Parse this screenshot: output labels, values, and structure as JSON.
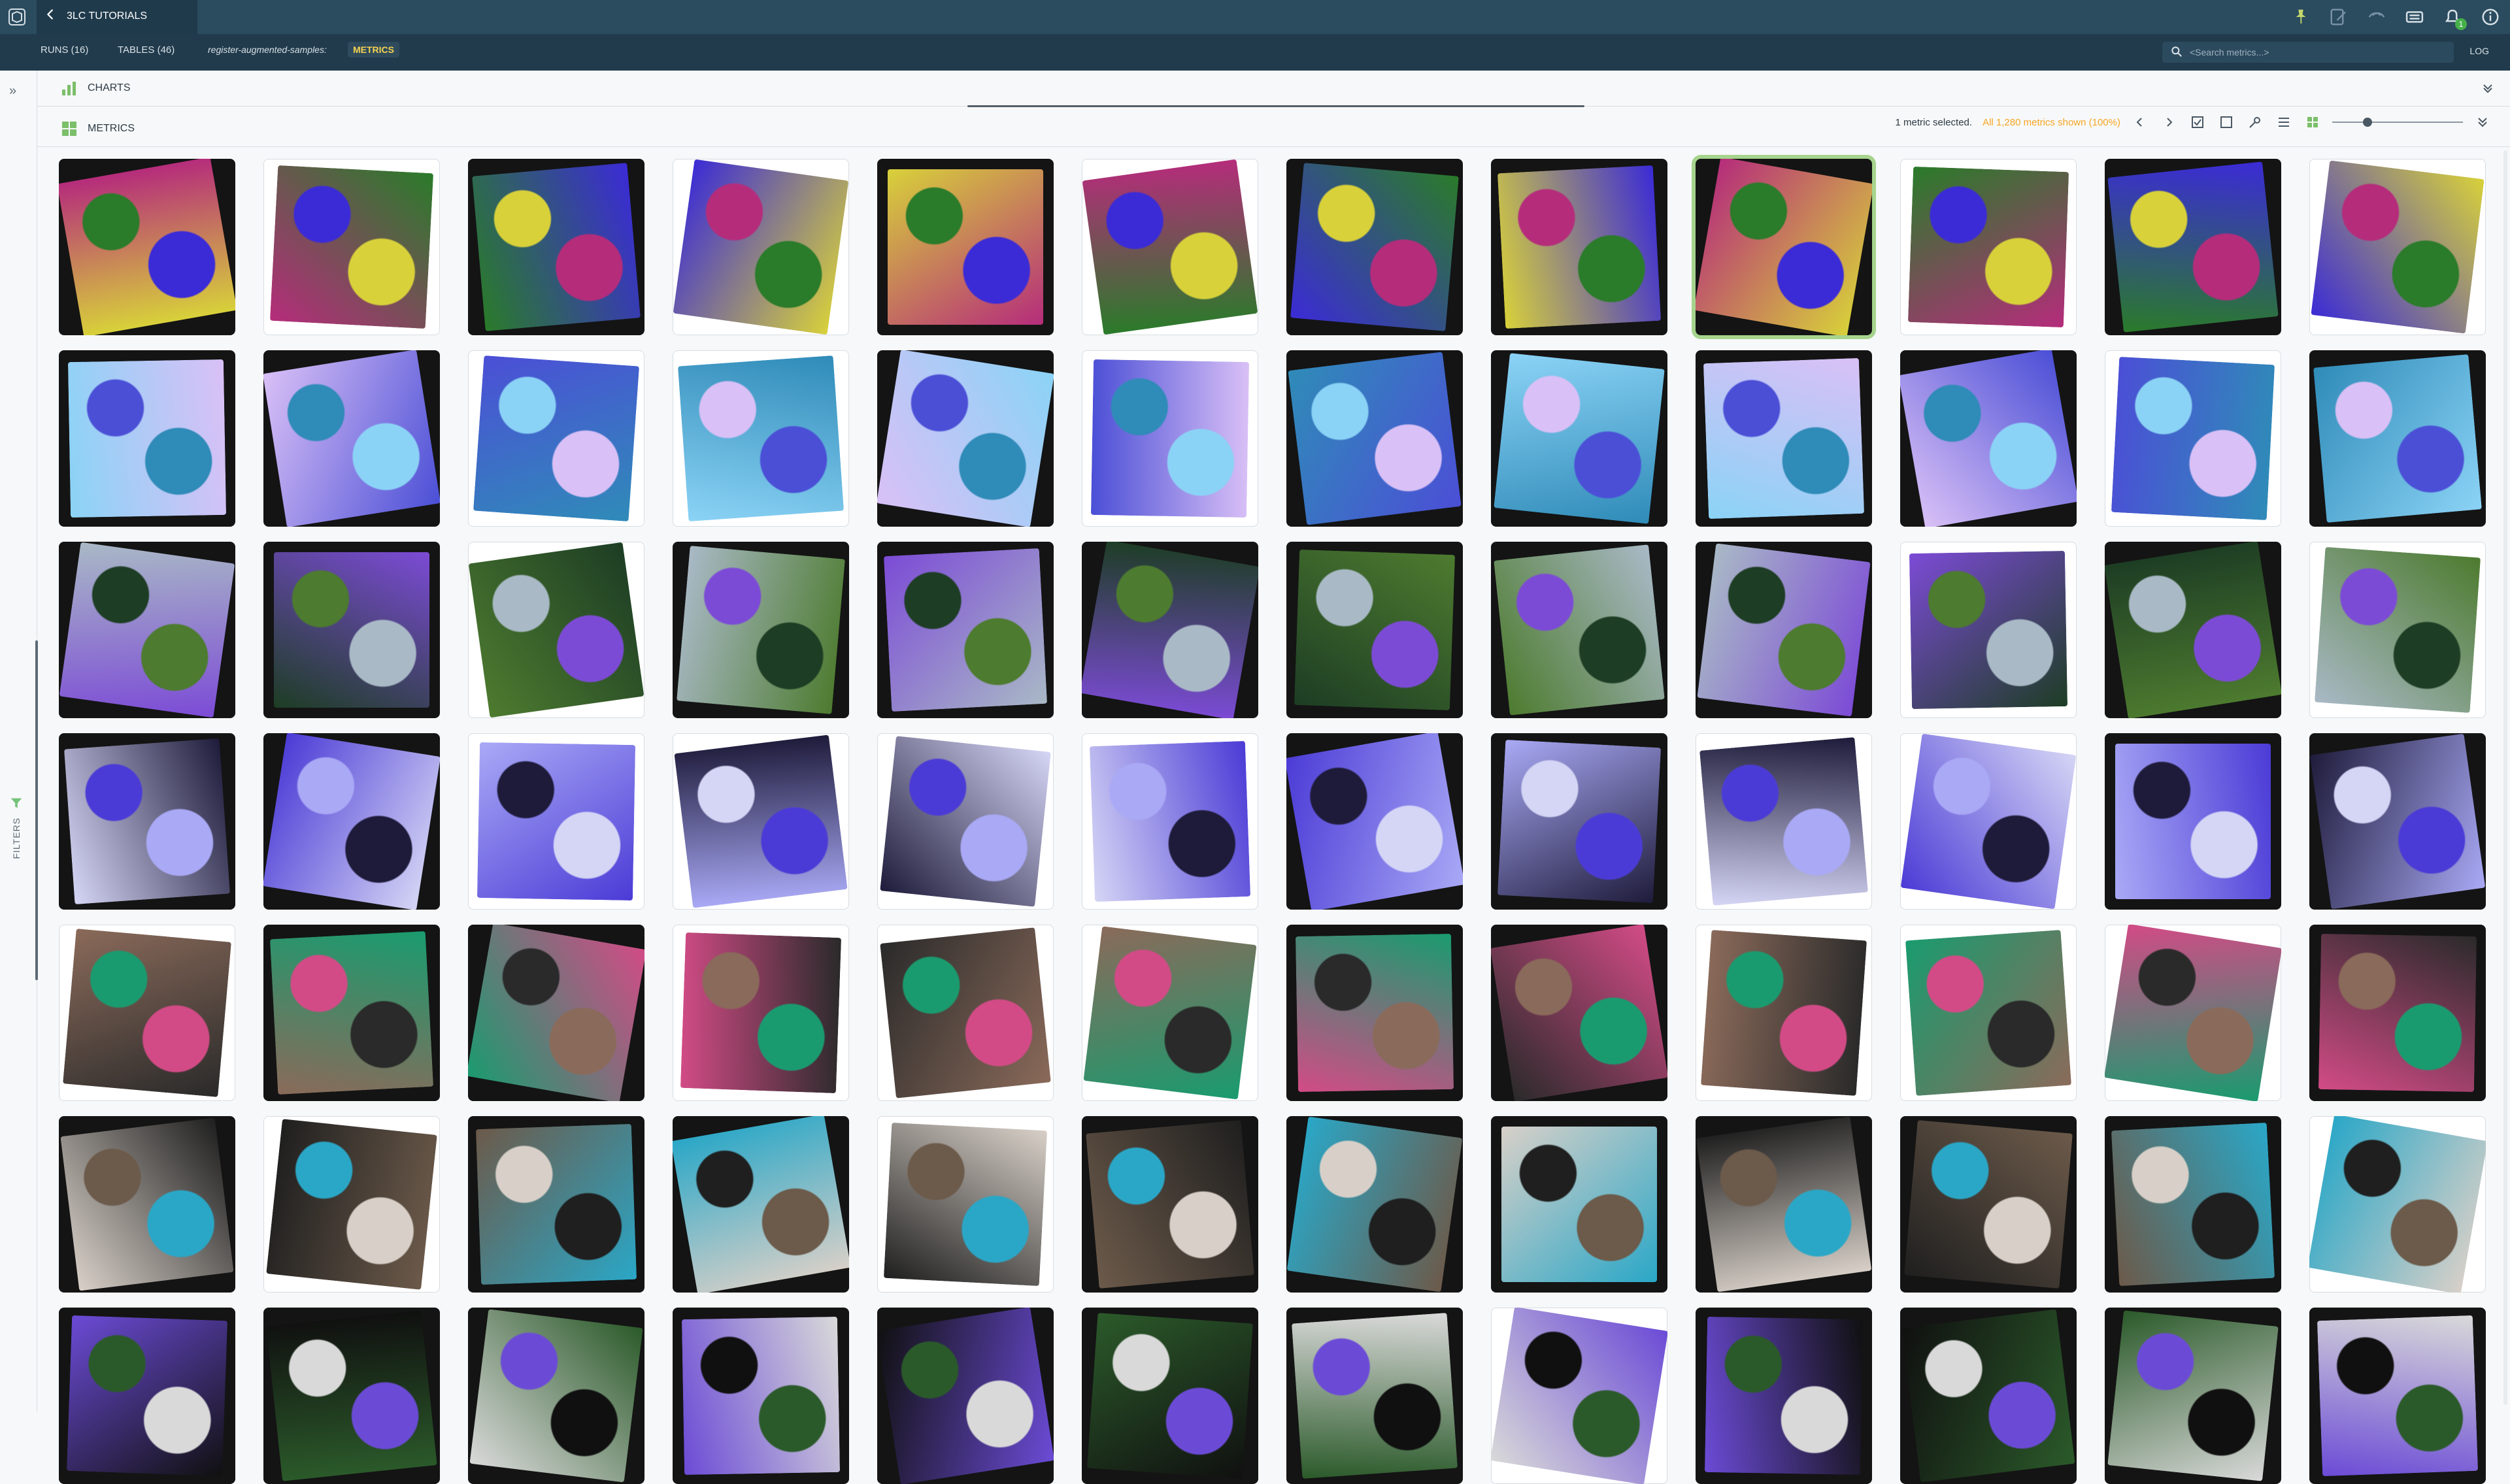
{
  "app": {
    "back_label": "3LC TUTORIALS",
    "tabs": [
      {
        "label": "RUNS (16)"
      },
      {
        "label": "TABLES (46)"
      }
    ],
    "breadcrumb": "register-augmented-samples:",
    "metrics_tab": "METRICS",
    "search_placeholder": "<Search metrics...>",
    "log_label": "LOG",
    "notifications_badge": "1"
  },
  "left_rail": {
    "filters_label": "FILTERS"
  },
  "charts_panel": {
    "title": "CHARTS"
  },
  "metrics_panel": {
    "title": "METRICS",
    "selection_text": "1 metric selected.",
    "shown_text": "All 1,280 metrics shown (100%)",
    "zoom_level": 0.25
  },
  "tiles": [
    {
      "name": "tile",
      "style": "dark",
      "selected": false
    },
    {
      "name": "tile",
      "style": "light",
      "selected": false
    },
    {
      "name": "tile",
      "style": "dark",
      "selected": false
    },
    {
      "name": "tile",
      "style": "light",
      "selected": false
    },
    {
      "name": "tile",
      "style": "dark",
      "selected": false
    },
    {
      "name": "tile",
      "style": "light",
      "selected": false
    },
    {
      "name": "tile",
      "style": "dark",
      "selected": false
    },
    {
      "name": "tile",
      "style": "dark",
      "selected": false
    },
    {
      "name": "tile",
      "style": "dark",
      "selected": true
    },
    {
      "name": "tile",
      "style": "light",
      "selected": false
    },
    {
      "name": "tile",
      "style": "dark",
      "selected": false
    },
    {
      "name": "tile",
      "style": "light",
      "selected": false
    },
    {
      "name": "tile",
      "style": "dark",
      "selected": false
    },
    {
      "name": "tile",
      "style": "dark",
      "selected": false
    },
    {
      "name": "tile",
      "style": "light",
      "selected": false
    },
    {
      "name": "tile",
      "style": "light",
      "selected": false
    },
    {
      "name": "tile",
      "style": "dark",
      "selected": false
    },
    {
      "name": "tile",
      "style": "light",
      "selected": false
    },
    {
      "name": "tile",
      "style": "dark",
      "selected": false
    },
    {
      "name": "tile",
      "style": "dark",
      "selected": false
    },
    {
      "name": "tile",
      "style": "dark",
      "selected": false
    },
    {
      "name": "tile",
      "style": "dark",
      "selected": false
    },
    {
      "name": "tile",
      "style": "light",
      "selected": false
    },
    {
      "name": "tile",
      "style": "dark",
      "selected": false
    },
    {
      "name": "tile",
      "style": "dark",
      "selected": false
    },
    {
      "name": "tile",
      "style": "dark",
      "selected": false
    },
    {
      "name": "tile",
      "style": "light",
      "selected": false
    },
    {
      "name": "tile",
      "style": "dark",
      "selected": false
    },
    {
      "name": "tile",
      "style": "dark",
      "selected": false
    },
    {
      "name": "tile",
      "style": "dark",
      "selected": false
    },
    {
      "name": "tile",
      "style": "dark",
      "selected": false
    },
    {
      "name": "tile",
      "style": "dark",
      "selected": false
    },
    {
      "name": "tile",
      "style": "dark",
      "selected": false
    },
    {
      "name": "tile",
      "style": "light",
      "selected": false
    },
    {
      "name": "tile",
      "style": "dark",
      "selected": false
    },
    {
      "name": "tile",
      "style": "light",
      "selected": false
    },
    {
      "name": "tile",
      "style": "dark",
      "selected": false
    },
    {
      "name": "tile",
      "style": "dark",
      "selected": false
    },
    {
      "name": "tile",
      "style": "light",
      "selected": false
    },
    {
      "name": "tile",
      "style": "light",
      "selected": false
    },
    {
      "name": "tile",
      "style": "light",
      "selected": false
    },
    {
      "name": "tile",
      "style": "light",
      "selected": false
    },
    {
      "name": "tile",
      "style": "dark",
      "selected": false
    },
    {
      "name": "tile",
      "style": "dark",
      "selected": false
    },
    {
      "name": "tile",
      "style": "light",
      "selected": false
    },
    {
      "name": "tile",
      "style": "light",
      "selected": false
    },
    {
      "name": "tile",
      "style": "dark",
      "selected": false
    },
    {
      "name": "tile",
      "style": "dark",
      "selected": false
    },
    {
      "name": "tile",
      "style": "light",
      "selected": false
    },
    {
      "name": "tile",
      "style": "dark",
      "selected": false
    },
    {
      "name": "tile",
      "style": "dark",
      "selected": false
    },
    {
      "name": "tile",
      "style": "light",
      "selected": false
    },
    {
      "name": "tile",
      "style": "light",
      "selected": false
    },
    {
      "name": "tile",
      "style": "light",
      "selected": false
    },
    {
      "name": "tile",
      "style": "dark",
      "selected": false
    },
    {
      "name": "tile",
      "style": "dark",
      "selected": false
    },
    {
      "name": "tile",
      "style": "light",
      "selected": false
    },
    {
      "name": "tile",
      "style": "light",
      "selected": false
    },
    {
      "name": "tile",
      "style": "light",
      "selected": false
    },
    {
      "name": "tile",
      "style": "dark",
      "selected": false
    },
    {
      "name": "tile",
      "style": "dark",
      "selected": false
    },
    {
      "name": "tile",
      "style": "light",
      "selected": false
    },
    {
      "name": "tile",
      "style": "dark",
      "selected": false
    },
    {
      "name": "tile",
      "style": "dark",
      "selected": false
    },
    {
      "name": "tile",
      "style": "light",
      "selected": false
    },
    {
      "name": "tile",
      "style": "dark",
      "selected": false
    },
    {
      "name": "tile",
      "style": "dark",
      "selected": false
    },
    {
      "name": "tile",
      "style": "dark",
      "selected": false
    },
    {
      "name": "tile",
      "style": "dark",
      "selected": false
    },
    {
      "name": "tile",
      "style": "dark",
      "selected": false
    },
    {
      "name": "tile",
      "style": "dark",
      "selected": false
    },
    {
      "name": "tile",
      "style": "light",
      "selected": false
    },
    {
      "name": "tile",
      "style": "dark",
      "selected": false
    },
    {
      "name": "tile",
      "style": "dark",
      "selected": false
    },
    {
      "name": "tile",
      "style": "dark",
      "selected": false
    },
    {
      "name": "tile",
      "style": "dark",
      "selected": false
    },
    {
      "name": "tile",
      "style": "dark",
      "selected": false
    },
    {
      "name": "tile",
      "style": "dark",
      "selected": false
    },
    {
      "name": "tile",
      "style": "dark",
      "selected": false
    },
    {
      "name": "tile",
      "style": "light",
      "selected": false
    },
    {
      "name": "tile",
      "style": "dark",
      "selected": false
    },
    {
      "name": "tile",
      "style": "dark",
      "selected": false
    },
    {
      "name": "tile",
      "style": "dark",
      "selected": false
    },
    {
      "name": "tile",
      "style": "dark",
      "selected": false
    }
  ]
}
